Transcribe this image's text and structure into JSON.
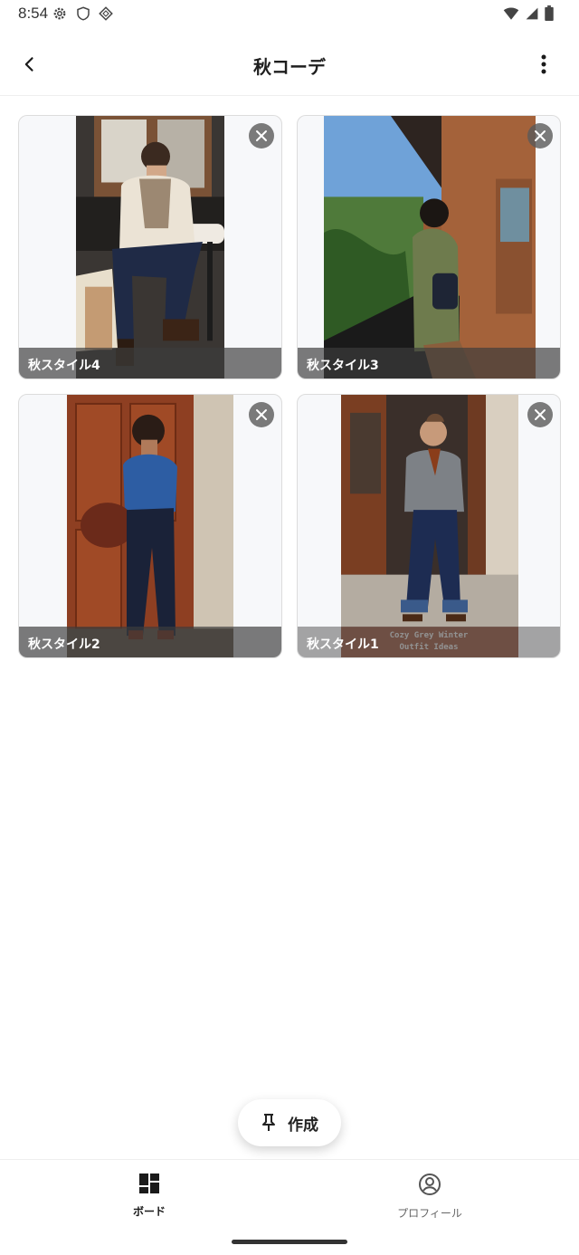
{
  "status_bar": {
    "time": "8:54"
  },
  "header": {
    "title": "秋コーデ"
  },
  "cards": [
    {
      "label": "秋スタイル4",
      "overlay_text": ""
    },
    {
      "label": "秋スタイル3",
      "overlay_text": ""
    },
    {
      "label": "秋スタイル2",
      "overlay_text": ""
    },
    {
      "label": "秋スタイル1",
      "overlay_text": "Cozy Grey Winter\nOutfit Ideas"
    }
  ],
  "fab": {
    "label": "作成",
    "icon": "pin-icon"
  },
  "bottom_nav": [
    {
      "label": "ボード",
      "icon": "dashboard-icon",
      "active": true
    },
    {
      "label": "プロフィール",
      "icon": "account-circle-icon",
      "active": false
    }
  ],
  "colors": {
    "accent": "#1a1a1a",
    "label_overlay": "#3c3c3c"
  }
}
